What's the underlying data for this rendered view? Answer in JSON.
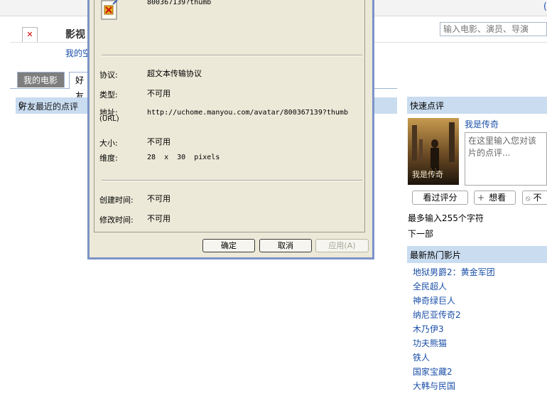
{
  "page": {
    "site_title": "影视",
    "search_placeholder": "输入电影、演员、导演",
    "my_space_link": "我的空",
    "tabs": [
      "我的电影",
      "好友"
    ],
    "friend_reviews_heading": "好友最近的点评",
    "friend_reviews_count": "0"
  },
  "quick_review": {
    "heading": "快速点评",
    "movie_title": "我是传奇",
    "poster_caption": "我是传奇",
    "placeholder": "在这里输入您对该片的点评...",
    "rate_label": "看过评分",
    "wish_label": "想看",
    "skip_label": "不",
    "char_limit": "最多输入255个字符",
    "next_label": "下一部"
  },
  "hot_movies": {
    "heading": "最新热门影片",
    "items": [
      "地狱男爵2：黄金军团",
      "全民超人",
      "神奇绿巨人",
      "纳尼亚传奇2",
      "木乃伊3",
      "功夫熊猫",
      "铁人",
      "国家宝藏2",
      "大韩与民国"
    ]
  },
  "dialog": {
    "filename": "800367139?thumb",
    "protocol_label": "协议:",
    "protocol_value": "超文本传输协议",
    "type_label": "类型:",
    "type_value": "不可用",
    "address_label": "地址:",
    "address_sub": "(URL)",
    "address_value": "http://uchome.manyou.com/avatar/800367139?thumb",
    "size_label": "大小:",
    "size_value": "不可用",
    "dimensions_label": "维度:",
    "dimensions_value": "28  x  30  pixels",
    "created_label": "创建时间:",
    "created_value": "不可用",
    "modified_label": "修改时间:",
    "modified_value": "不可用",
    "ok_label": "确定",
    "cancel_label": "取消",
    "apply_label": "应用(A)"
  },
  "colors": {
    "link": "#1b4fa8",
    "section_bar": "#c9dcf0",
    "dialog_face": "#ece9d8",
    "dialog_frame": "#7c93c9"
  }
}
